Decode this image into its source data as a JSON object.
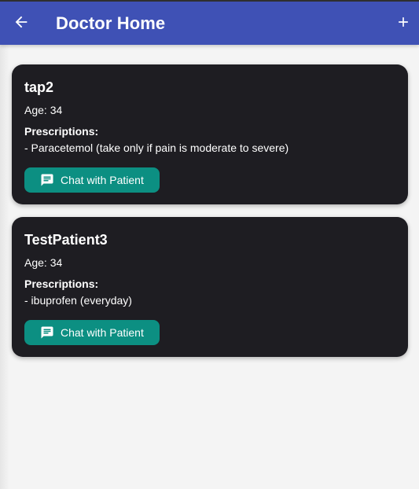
{
  "appbar": {
    "title": "Doctor Home",
    "back_icon": "arrow-left-icon",
    "add_icon": "plus-icon",
    "color": "#3f51b5"
  },
  "patients": [
    {
      "name": "tap2",
      "age_text": "Age: 34",
      "prescriptions_label": "Prescriptions:",
      "prescription_item": "- Paracetemol (take only if pain is moderate to severe)",
      "chat_button_label": "Chat with Patient",
      "chat_icon": "message-icon"
    },
    {
      "name": "TestPatient3",
      "age_text": "Age: 34",
      "prescriptions_label": "Prescriptions:",
      "prescription_item": "- ibuprofen (everyday)",
      "chat_button_label": "Chat with Patient",
      "chat_icon": "message-icon"
    }
  ],
  "colors": {
    "card_background": "#1e1d22",
    "button_background": "#0c8f82",
    "page_background": "#f4f4f4"
  }
}
